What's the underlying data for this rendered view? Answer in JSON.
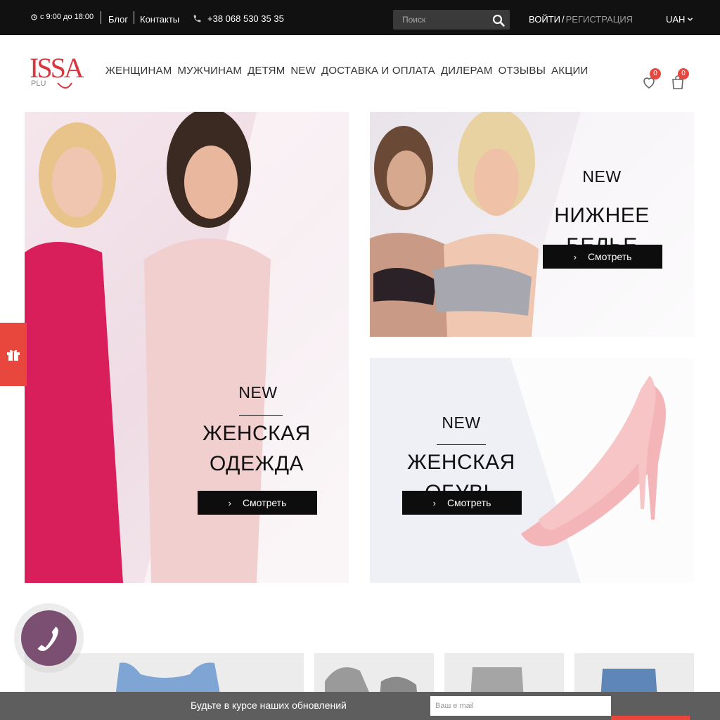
{
  "topbar": {
    "hours": "с 9:00 до 18:00",
    "blog": "Блог",
    "contacts": "Контакты",
    "phone": "+38 068 530 35 35",
    "search_placeholder": "Поиск",
    "login": "ВОЙТИ",
    "separator": "/",
    "register": "РЕГИСТРАЦИЯ",
    "currency": "UAH"
  },
  "logo": {
    "main": "ISSA",
    "sub": "PLU"
  },
  "nav": [
    "ЖЕНЩИНАМ",
    "МУЖЧИНАМ",
    "ДЕТЯМ",
    "NEW",
    "ДОСТАВКА И ОПЛАТА",
    "ДИЛЕРАМ",
    "ОТЗЫВЫ",
    "АКЦИИ"
  ],
  "header": {
    "wishlist_count": "0",
    "cart_count": "0"
  },
  "banners": [
    {
      "new": "NEW",
      "title_line1": "ЖЕНСКАЯ",
      "title_line2": "ОДЕЖДА",
      "button": "Смотреть"
    },
    {
      "new": "NEW",
      "title_line1": "НИЖНЕЕ БЕЛЬЕ",
      "button": "Смотреть"
    },
    {
      "new": "NEW",
      "title_line1": "ЖЕНСКАЯ ОБУВЬ",
      "button": "Смотреть"
    }
  ],
  "newsletter": {
    "label": "Будьте в курсе наших обновлений",
    "placeholder": "Ваш e mail"
  },
  "colors": {
    "accent": "#e8473d",
    "phone_bubble": "#7b4f72",
    "topbar": "#111111",
    "newsletter_bar": "#5e5e5e"
  }
}
